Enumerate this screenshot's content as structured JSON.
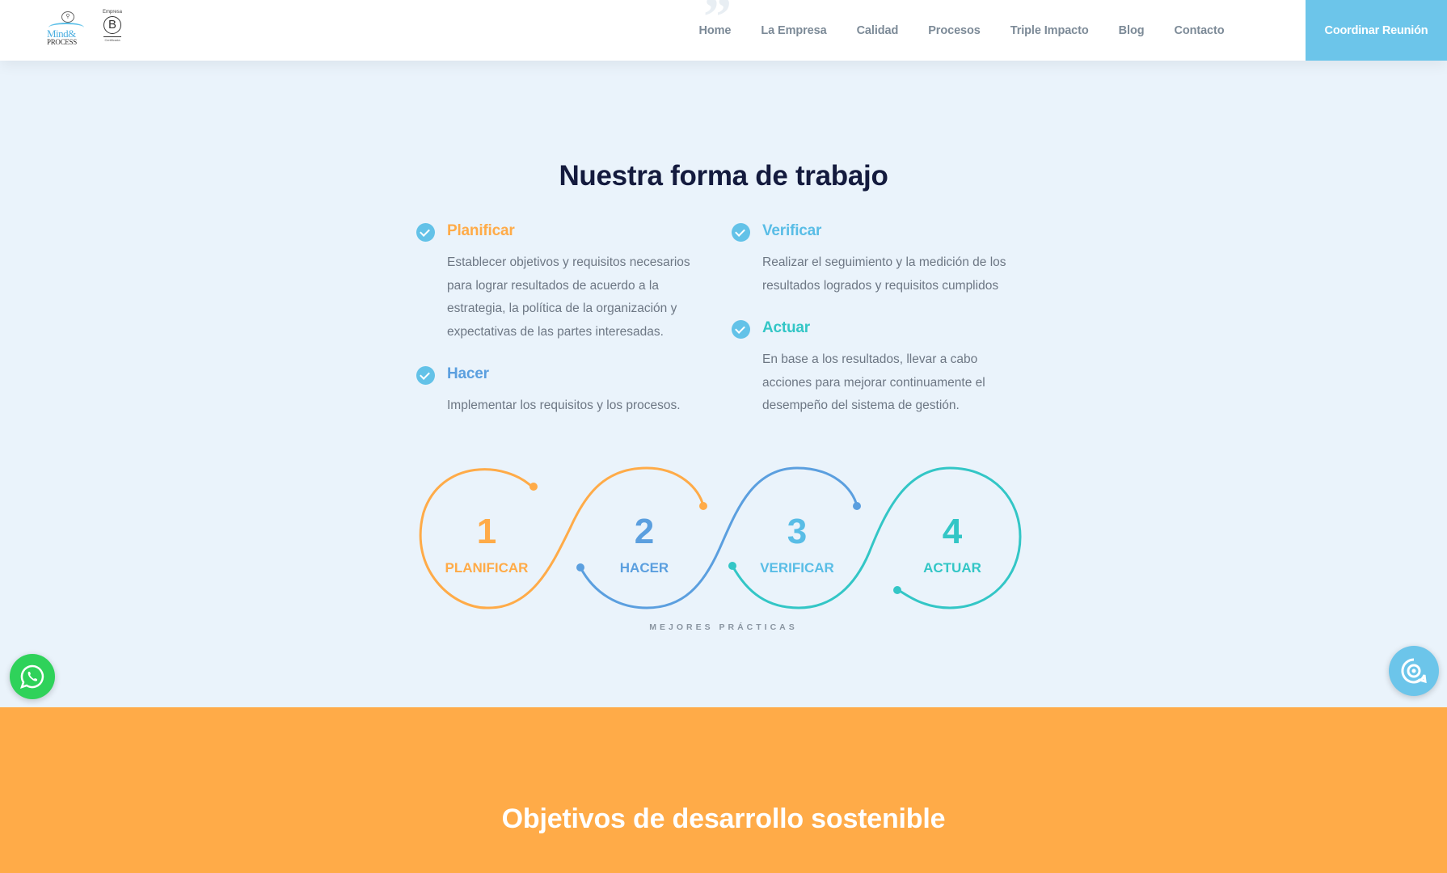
{
  "brand": {
    "logo_line1": "Mind&",
    "logo_line2": "PROCESS",
    "b_corp_top": "Empresa",
    "b_corp_letter": "B",
    "b_corp_bottom": "Certificada"
  },
  "nav": {
    "items": [
      "Home",
      "La Empresa",
      "Calidad",
      "Procesos",
      "Triple Impacto",
      "Blog",
      "Contacto"
    ],
    "cta_label": "Coordinar Reunión"
  },
  "section": {
    "title": "Nuestra forma de trabajo",
    "steps": [
      {
        "label": "Planificar",
        "color": "#ffab48",
        "description": "Establecer objetivos y requisitos necesarios para lograr resultados de acuerdo a la estrategia, la política de la organización y expectativas de las partes interesadas."
      },
      {
        "label": "Hacer",
        "color": "#5b9fdf",
        "description": "Implementar los requisitos y los procesos."
      },
      {
        "label": "Verificar",
        "color": "#59bde6",
        "description": "Realizar el seguimiento y la medición de los resultados logrados y requisitos cumplidos"
      },
      {
        "label": "Actuar",
        "color": "#33c6c6",
        "description": "En base a los resultados, llevar a cabo acciones para mejorar continuamente el desempeño del sistema de gestión."
      }
    ]
  },
  "diagram": {
    "stages": [
      {
        "number": "1",
        "label": "PLANIFICAR",
        "color": "#ffab48"
      },
      {
        "number": "2",
        "label": "HACER",
        "color": "#5b9fdf"
      },
      {
        "number": "3",
        "label": "VERIFICAR",
        "color": "#59bde6"
      },
      {
        "number": "4",
        "label": "ACTUAR",
        "color": "#33c6c6"
      }
    ],
    "caption": "MEJORES PRÁCTICAS"
  },
  "sdg": {
    "title": "Objetivos de desarrollo sostenible",
    "background": "#ffab48"
  },
  "floating": {
    "whatsapp_icon": "whatsapp-icon",
    "support_icon": "chat-support-icon"
  }
}
